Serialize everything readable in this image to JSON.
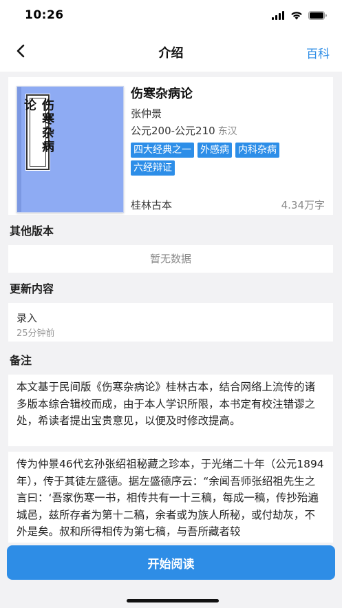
{
  "status": {
    "time": "10:26"
  },
  "nav": {
    "title": "介绍",
    "right_label": "百科"
  },
  "book": {
    "cover_title": "伤寒杂病论",
    "title": "伤寒杂病论",
    "author": "张仲景",
    "date": "公元200-公元210",
    "dynasty": "东汉",
    "tags": [
      "四大经典之一",
      "外感病",
      "内科杂病",
      "六经辩证"
    ],
    "publisher": "桂林古本",
    "words": "4.34万字"
  },
  "sections": {
    "other_versions": {
      "title": "其他版本",
      "empty_text": "暂无数据"
    },
    "updates": {
      "title": "更新内容",
      "item_title": "录入",
      "item_time": "25分钟前"
    },
    "notes": {
      "title": "备注",
      "paragraph1": "本文基于民间版《伤寒杂病论》桂林古本，结合网络上流传的诸多版本综合辑校而成，由于本人学识所限，本书定有校注错谬之处，希读者提出宝贵意见，以便及时修改提高。",
      "paragraph2": "传为仲景46代玄孙张绍祖秘藏之珍本，于光绪二十年（公元1894年），传于其徒左盛德。据左盛德序云：“余闻吾师张绍祖先生之言曰：‘吾家伤寒一书，相传共有一十三稿，每成一稿，传抄殆遍城邑，兹所存者为第十二稿，余者或为族人所秘，或付劫灰，不外是矣。叔和所得相传为第七稿，与吾所藏者较"
    }
  },
  "bottom": {
    "start_label": "开始阅读"
  },
  "colors": {
    "accent": "#2e8de6",
    "cover": "#8eabf3",
    "background": "#f2f2f4"
  }
}
